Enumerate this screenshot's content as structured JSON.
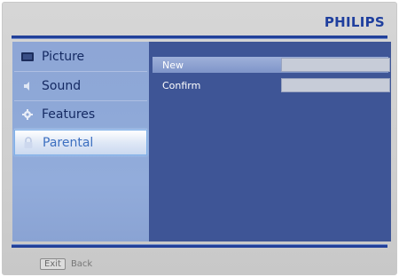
{
  "brand": "PHILIPS",
  "menu": {
    "items": [
      {
        "label": "Picture",
        "icon": "tv-icon"
      },
      {
        "label": "Sound",
        "icon": "speaker-icon"
      },
      {
        "label": "Features",
        "icon": "gear-icon"
      },
      {
        "label": "Parental",
        "icon": "lock-icon",
        "selected": true
      }
    ]
  },
  "panel": {
    "rows": [
      {
        "label": "New",
        "value": "",
        "active": true
      },
      {
        "label": "Confirm",
        "value": ""
      }
    ]
  },
  "footer": {
    "key": "Exit",
    "action": "Back"
  },
  "colors": {
    "brand": "#1f3f9e",
    "panel_bg": "#3e5596",
    "menu_bg": "#8ea6d6",
    "highlight": "#7fb0e8"
  }
}
